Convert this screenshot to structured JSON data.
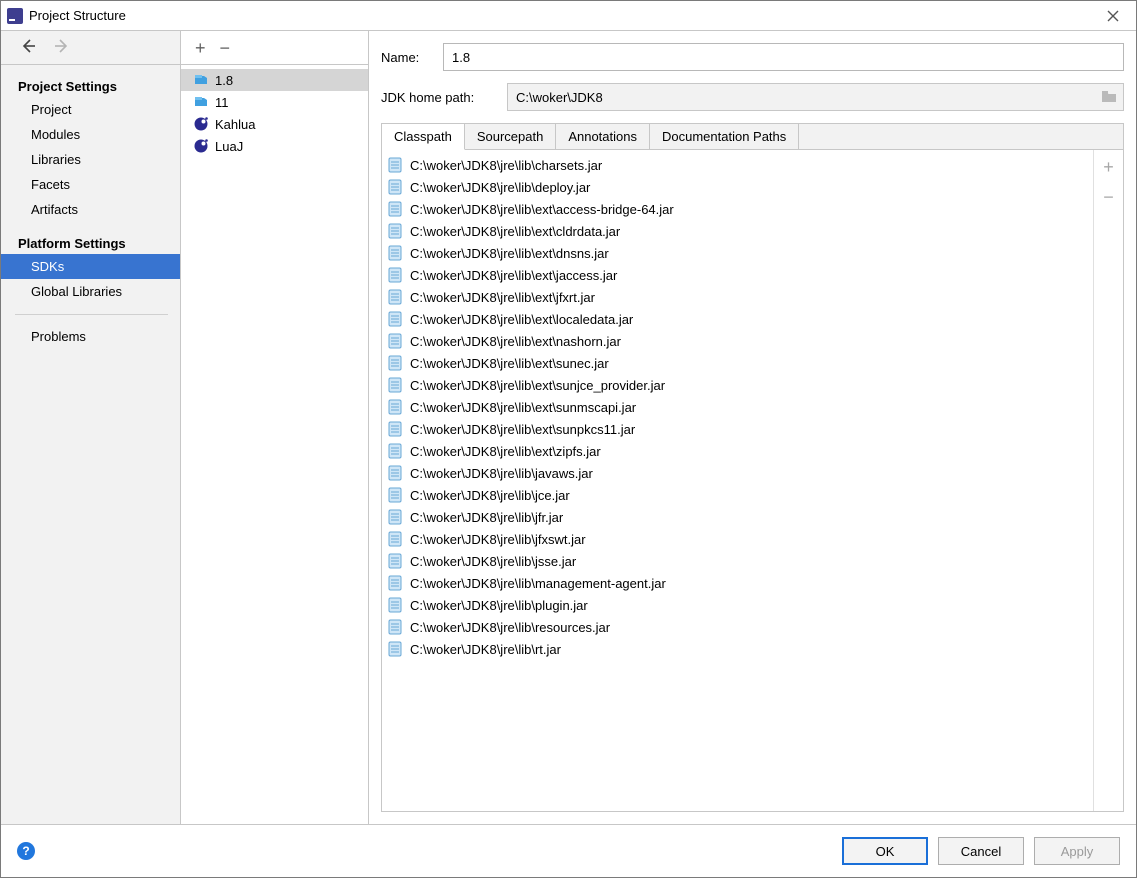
{
  "window": {
    "title": "Project Structure"
  },
  "sidebar": {
    "sections": [
      {
        "header": "Project Settings",
        "items": [
          "Project",
          "Modules",
          "Libraries",
          "Facets",
          "Artifacts"
        ]
      },
      {
        "header": "Platform Settings",
        "items": [
          "SDKs",
          "Global Libraries"
        ]
      }
    ],
    "extra": [
      "Problems"
    ],
    "selected": "SDKs"
  },
  "sdk_list": {
    "items": [
      {
        "label": "1.8",
        "kind": "jdk"
      },
      {
        "label": "11",
        "kind": "jdk"
      },
      {
        "label": "Kahlua",
        "kind": "lua"
      },
      {
        "label": "LuaJ",
        "kind": "lua"
      }
    ],
    "selected": "1.8"
  },
  "form": {
    "name_label": "Name:",
    "name_value": "1.8",
    "path_label": "JDK home path:",
    "path_value": "C:\\woker\\JDK8"
  },
  "tabs": {
    "items": [
      "Classpath",
      "Sourcepath",
      "Annotations",
      "Documentation Paths"
    ],
    "active": "Classpath"
  },
  "classpath": [
    "C:\\woker\\JDK8\\jre\\lib\\charsets.jar",
    "C:\\woker\\JDK8\\jre\\lib\\deploy.jar",
    "C:\\woker\\JDK8\\jre\\lib\\ext\\access-bridge-64.jar",
    "C:\\woker\\JDK8\\jre\\lib\\ext\\cldrdata.jar",
    "C:\\woker\\JDK8\\jre\\lib\\ext\\dnsns.jar",
    "C:\\woker\\JDK8\\jre\\lib\\ext\\jaccess.jar",
    "C:\\woker\\JDK8\\jre\\lib\\ext\\jfxrt.jar",
    "C:\\woker\\JDK8\\jre\\lib\\ext\\localedata.jar",
    "C:\\woker\\JDK8\\jre\\lib\\ext\\nashorn.jar",
    "C:\\woker\\JDK8\\jre\\lib\\ext\\sunec.jar",
    "C:\\woker\\JDK8\\jre\\lib\\ext\\sunjce_provider.jar",
    "C:\\woker\\JDK8\\jre\\lib\\ext\\sunmscapi.jar",
    "C:\\woker\\JDK8\\jre\\lib\\ext\\sunpkcs11.jar",
    "C:\\woker\\JDK8\\jre\\lib\\ext\\zipfs.jar",
    "C:\\woker\\JDK8\\jre\\lib\\javaws.jar",
    "C:\\woker\\JDK8\\jre\\lib\\jce.jar",
    "C:\\woker\\JDK8\\jre\\lib\\jfr.jar",
    "C:\\woker\\JDK8\\jre\\lib\\jfxswt.jar",
    "C:\\woker\\JDK8\\jre\\lib\\jsse.jar",
    "C:\\woker\\JDK8\\jre\\lib\\management-agent.jar",
    "C:\\woker\\JDK8\\jre\\lib\\plugin.jar",
    "C:\\woker\\JDK8\\jre\\lib\\resources.jar",
    "C:\\woker\\JDK8\\jre\\lib\\rt.jar"
  ],
  "buttons": {
    "ok": "OK",
    "cancel": "Cancel",
    "apply": "Apply"
  }
}
